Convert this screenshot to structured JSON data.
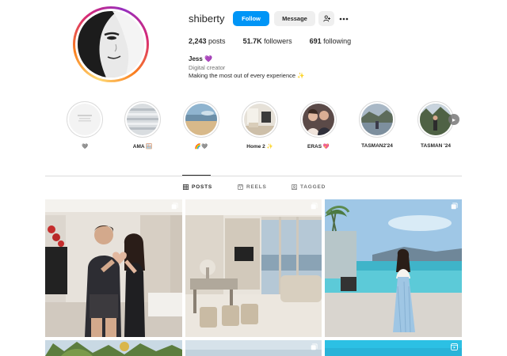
{
  "profile": {
    "username": "shiberty",
    "buttons": {
      "follow": "Follow",
      "message": "Message"
    },
    "stats": {
      "posts_count": "2,243",
      "posts_label": "posts",
      "followers_count": "51.7K",
      "followers_label": "followers",
      "following_count": "691",
      "following_label": "following"
    },
    "bio": {
      "name": "Jess 💜",
      "category": "Digital creator",
      "text": "Making the most out of every experience ✨"
    }
  },
  "highlights": [
    {
      "label": "🩶"
    },
    {
      "label": "AMA 🪟"
    },
    {
      "label": "🌈🩶"
    },
    {
      "label": "Home 2 ✨"
    },
    {
      "label": "ERAS 💖"
    },
    {
      "label": "TASMAN2'24"
    },
    {
      "label": "TASMAN '24"
    }
  ],
  "tabs": [
    {
      "label": "POSTS",
      "icon": "grid-icon",
      "active": true
    },
    {
      "label": "REELS",
      "icon": "reels-icon",
      "active": false
    },
    {
      "label": "TAGGED",
      "icon": "tagged-icon",
      "active": false
    }
  ],
  "posts": [
    {
      "subject": "couple making heart hands in living room",
      "badge": "carousel-icon"
    },
    {
      "subject": "modern condo living and dining room",
      "badge": "carousel-icon"
    },
    {
      "subject": "woman by infinity pool with sea view",
      "badge": "carousel-icon"
    },
    {
      "subject": "palm trees",
      "badge": ""
    },
    {
      "subject": "sky",
      "badge": "carousel-icon"
    },
    {
      "subject": "sky",
      "badge": "reels-icon"
    }
  ],
  "colors": {
    "accent": "#0095f6",
    "text": "#262626",
    "muted": "#737373",
    "border": "#dbdbdb"
  }
}
